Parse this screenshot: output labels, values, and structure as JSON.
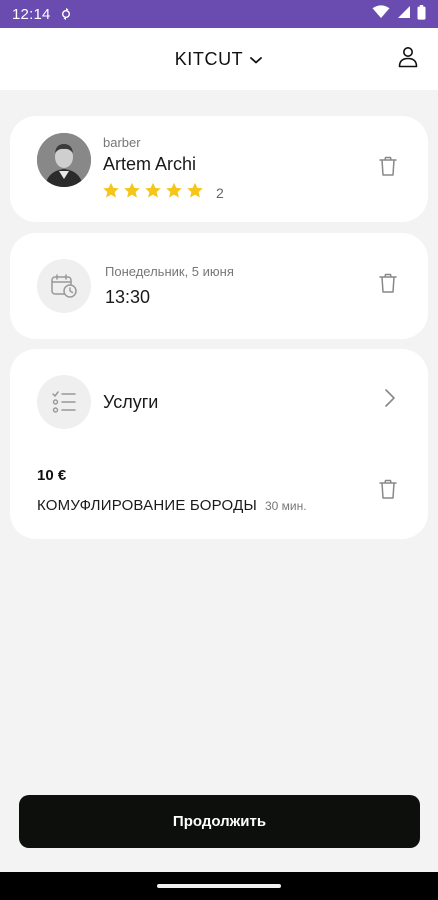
{
  "status_bar": {
    "time": "12:14",
    "icons": [
      "sync-icon",
      "wifi-icon",
      "signal-icon",
      "battery-icon"
    ]
  },
  "header": {
    "brand": "KITCUT",
    "brand_icon": "chevron-down-icon",
    "profile_icon": "user-icon"
  },
  "barber_card": {
    "role": "barber",
    "name": "Artem Archi",
    "rating_stars": 5,
    "rating_count": "2",
    "star_color": "#f5c518",
    "delete_icon": "trash-icon"
  },
  "datetime_card": {
    "icon": "calendar-clock-icon",
    "date": "Понедельник, 5 июня",
    "time": "13:30",
    "delete_icon": "trash-icon"
  },
  "services_card": {
    "icon": "checklist-icon",
    "title": "Услуги",
    "chevron_icon": "chevron-right-icon",
    "items": [
      {
        "price": "10 €",
        "name": "КОМУФЛИРОВАНИЕ БОРОДЫ",
        "duration": "30 мин.",
        "delete_icon": "trash-icon"
      }
    ]
  },
  "footer": {
    "continue_label": "Продолжить"
  },
  "colors": {
    "status_bar": "#6a4bb0",
    "background": "#f3f3f3",
    "card": "#ffffff",
    "button": "#0d0f0d",
    "star": "#f5c518"
  }
}
